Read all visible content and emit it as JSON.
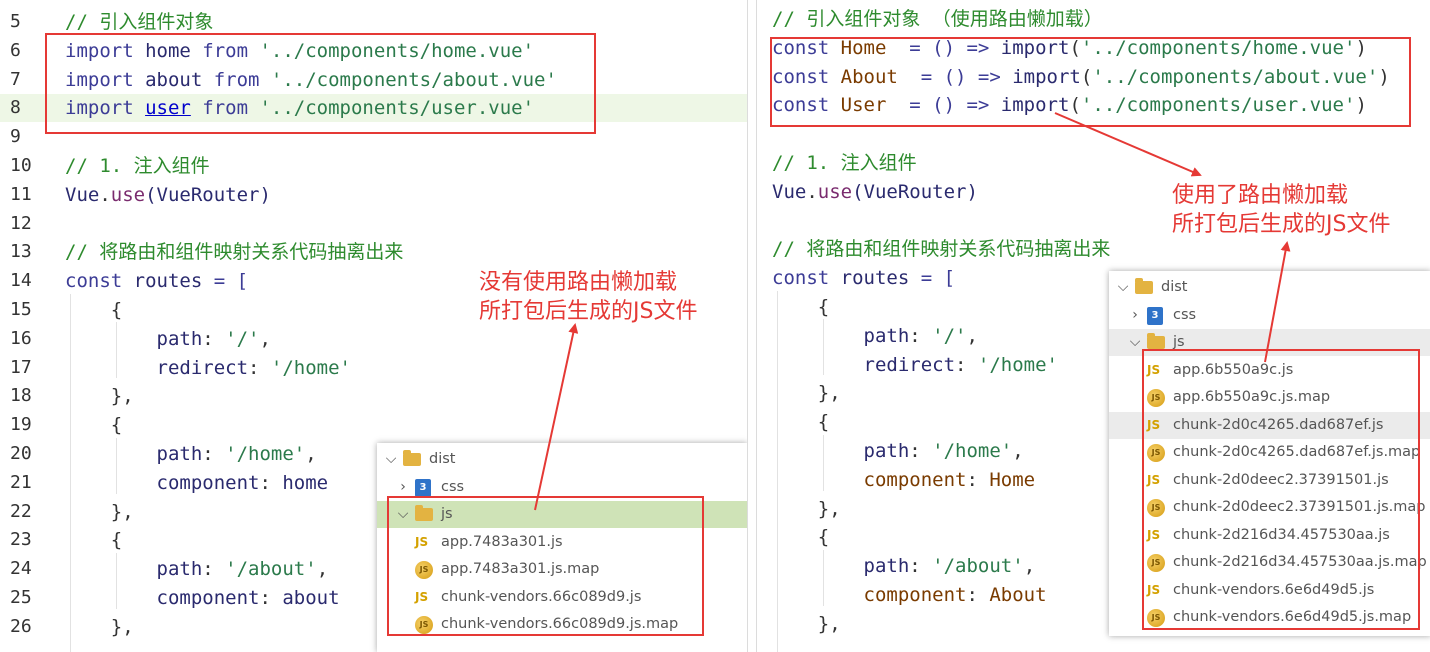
{
  "left": {
    "lines": [
      {
        "num": "5",
        "tokens": [
          {
            "t": "// 引入组件对象",
            "c": "comment"
          }
        ]
      },
      {
        "num": "6",
        "tokens": [
          {
            "t": "import ",
            "c": "kw"
          },
          {
            "t": "home ",
            "c": "ident"
          },
          {
            "t": "from ",
            "c": "kw"
          },
          {
            "t": "'../components/home.vue'",
            "c": "str"
          }
        ]
      },
      {
        "num": "7",
        "tokens": [
          {
            "t": "import ",
            "c": "kw"
          },
          {
            "t": "about ",
            "c": "ident"
          },
          {
            "t": "from ",
            "c": "kw"
          },
          {
            "t": "'../components/about.vue'",
            "c": "str"
          }
        ]
      },
      {
        "num": "8",
        "tokens": [
          {
            "t": "import ",
            "c": "kw"
          },
          {
            "t": "user",
            "c": "link"
          },
          {
            "t": " from ",
            "c": "kw"
          },
          {
            "t": "'../components/user.vue'",
            "c": "str"
          }
        ]
      },
      {
        "num": "9",
        "tokens": []
      },
      {
        "num": "10",
        "tokens": [
          {
            "t": "// 1. 注入组件",
            "c": "comment"
          }
        ]
      },
      {
        "num": "11",
        "tokens": [
          {
            "t": "Vue",
            "c": "ident"
          },
          {
            "t": ".",
            "c": "punc"
          },
          {
            "t": "use",
            "c": "prop"
          },
          {
            "t": "(VueRouter)",
            "c": "ident"
          }
        ]
      },
      {
        "num": "12",
        "tokens": []
      },
      {
        "num": "13",
        "tokens": [
          {
            "t": "// 将路由和组件映射关系代码抽离出来",
            "c": "comment"
          }
        ]
      },
      {
        "num": "14",
        "tokens": [
          {
            "t": "const ",
            "c": "kw"
          },
          {
            "t": "routes ",
            "c": "ident"
          },
          {
            "t": "= [",
            "c": "op"
          }
        ]
      },
      {
        "num": "15",
        "tokens": [
          {
            "t": "    {",
            "c": "punc"
          }
        ]
      },
      {
        "num": "16",
        "tokens": [
          {
            "t": "        path",
            "c": "ident"
          },
          {
            "t": ": ",
            "c": "punc"
          },
          {
            "t": "'/'",
            "c": "str"
          },
          {
            "t": ",",
            "c": "punc"
          }
        ]
      },
      {
        "num": "17",
        "tokens": [
          {
            "t": "        redirect",
            "c": "ident"
          },
          {
            "t": ": ",
            "c": "punc"
          },
          {
            "t": "'/home'",
            "c": "str"
          }
        ]
      },
      {
        "num": "18",
        "tokens": [
          {
            "t": "    },",
            "c": "punc"
          }
        ]
      },
      {
        "num": "19",
        "tokens": [
          {
            "t": "    {",
            "c": "punc"
          }
        ]
      },
      {
        "num": "20",
        "tokens": [
          {
            "t": "        path",
            "c": "ident"
          },
          {
            "t": ": ",
            "c": "punc"
          },
          {
            "t": "'/home'",
            "c": "str"
          },
          {
            "t": ",",
            "c": "punc"
          }
        ]
      },
      {
        "num": "21",
        "tokens": [
          {
            "t": "        component",
            "c": "ident"
          },
          {
            "t": ": ",
            "c": "punc"
          },
          {
            "t": "home",
            "c": "ident"
          }
        ]
      },
      {
        "num": "22",
        "tokens": [
          {
            "t": "    },",
            "c": "punc"
          }
        ]
      },
      {
        "num": "23",
        "tokens": [
          {
            "t": "    {",
            "c": "punc"
          }
        ]
      },
      {
        "num": "24",
        "tokens": [
          {
            "t": "        path",
            "c": "ident"
          },
          {
            "t": ": ",
            "c": "punc"
          },
          {
            "t": "'/about'",
            "c": "str"
          },
          {
            "t": ",",
            "c": "punc"
          }
        ]
      },
      {
        "num": "25",
        "tokens": [
          {
            "t": "        component",
            "c": "ident"
          },
          {
            "t": ": ",
            "c": "punc"
          },
          {
            "t": "about",
            "c": "ident"
          }
        ]
      },
      {
        "num": "26",
        "tokens": [
          {
            "t": "    },",
            "c": "punc"
          }
        ]
      }
    ],
    "annotation": [
      "没有使用路由懒加载",
      "所打包后生成的JS文件"
    ],
    "explorer": {
      "rows": [
        {
          "label": "dist",
          "chev": "⌵",
          "icon": "folder",
          "state": ""
        },
        {
          "label": "css",
          "chev": "›",
          "icon": "css",
          "state": ""
        },
        {
          "label": "js",
          "chev": "⌵",
          "icon": "folder",
          "state": "selected"
        },
        {
          "label": "app.7483a301.js",
          "chev": "",
          "icon": "js",
          "state": ""
        },
        {
          "label": "app.7483a301.js.map",
          "chev": "",
          "icon": "map",
          "state": ""
        },
        {
          "label": "chunk-vendors.66c089d9.js",
          "chev": "",
          "icon": "js",
          "state": ""
        },
        {
          "label": "chunk-vendors.66c089d9.js.map",
          "chev": "",
          "icon": "map",
          "state": ""
        }
      ]
    }
  },
  "right": {
    "lines": [
      {
        "tokens": [
          {
            "t": "// 引入组件对象 （使用路由懒加载）",
            "c": "comment"
          }
        ]
      },
      {
        "tokens": [
          {
            "t": "const ",
            "c": "kw"
          },
          {
            "t": "Home  ",
            "c": "cls"
          },
          {
            "t": "= () => ",
            "c": "op"
          },
          {
            "t": "import",
            "c": "ident"
          },
          {
            "t": "(",
            "c": "punc"
          },
          {
            "t": "'../components/home.vue'",
            "c": "str"
          },
          {
            "t": ")",
            "c": "punc"
          }
        ]
      },
      {
        "tokens": [
          {
            "t": "const ",
            "c": "kw"
          },
          {
            "t": "About  ",
            "c": "cls"
          },
          {
            "t": "= () => ",
            "c": "op"
          },
          {
            "t": "import",
            "c": "ident"
          },
          {
            "t": "(",
            "c": "punc"
          },
          {
            "t": "'../components/about.vue'",
            "c": "str"
          },
          {
            "t": ")",
            "c": "punc"
          }
        ]
      },
      {
        "tokens": [
          {
            "t": "const ",
            "c": "kw"
          },
          {
            "t": "User  ",
            "c": "cls"
          },
          {
            "t": "= () => ",
            "c": "op"
          },
          {
            "t": "import",
            "c": "ident"
          },
          {
            "t": "(",
            "c": "punc"
          },
          {
            "t": "'../components/user.vue'",
            "c": "str"
          },
          {
            "t": ")",
            "c": "punc"
          }
        ]
      },
      {
        "tokens": []
      },
      {
        "tokens": [
          {
            "t": "// 1. 注入组件",
            "c": "comment"
          }
        ]
      },
      {
        "tokens": [
          {
            "t": "Vue",
            "c": "ident"
          },
          {
            "t": ".",
            "c": "punc"
          },
          {
            "t": "use",
            "c": "prop"
          },
          {
            "t": "(VueRouter)",
            "c": "ident"
          }
        ]
      },
      {
        "tokens": []
      },
      {
        "tokens": [
          {
            "t": "// 将路由和组件映射关系代码抽离出来",
            "c": "comment"
          }
        ]
      },
      {
        "tokens": [
          {
            "t": "const ",
            "c": "kw"
          },
          {
            "t": "routes ",
            "c": "ident"
          },
          {
            "t": "= [",
            "c": "op"
          }
        ]
      },
      {
        "tokens": [
          {
            "t": "    {",
            "c": "punc"
          }
        ]
      },
      {
        "tokens": [
          {
            "t": "        path",
            "c": "ident"
          },
          {
            "t": ": ",
            "c": "punc"
          },
          {
            "t": "'/'",
            "c": "str"
          },
          {
            "t": ",",
            "c": "punc"
          }
        ]
      },
      {
        "tokens": [
          {
            "t": "        redirect",
            "c": "ident"
          },
          {
            "t": ": ",
            "c": "punc"
          },
          {
            "t": "'/home'",
            "c": "str"
          }
        ]
      },
      {
        "tokens": [
          {
            "t": "    },",
            "c": "punc"
          }
        ]
      },
      {
        "tokens": [
          {
            "t": "    {",
            "c": "punc"
          }
        ]
      },
      {
        "tokens": [
          {
            "t": "        path",
            "c": "ident"
          },
          {
            "t": ": ",
            "c": "punc"
          },
          {
            "t": "'/home'",
            "c": "str"
          },
          {
            "t": ",",
            "c": "punc"
          }
        ]
      },
      {
        "tokens": [
          {
            "t": "        component",
            "c": "cls"
          },
          {
            "t": ": ",
            "c": "punc"
          },
          {
            "t": "Home",
            "c": "cls"
          }
        ]
      },
      {
        "tokens": [
          {
            "t": "    },",
            "c": "punc"
          }
        ]
      },
      {
        "tokens": [
          {
            "t": "    {",
            "c": "punc"
          }
        ]
      },
      {
        "tokens": [
          {
            "t": "        path",
            "c": "ident"
          },
          {
            "t": ": ",
            "c": "punc"
          },
          {
            "t": "'/about'",
            "c": "str"
          },
          {
            "t": ",",
            "c": "punc"
          }
        ]
      },
      {
        "tokens": [
          {
            "t": "        component",
            "c": "cls"
          },
          {
            "t": ": ",
            "c": "punc"
          },
          {
            "t": "About",
            "c": "cls"
          }
        ]
      },
      {
        "tokens": [
          {
            "t": "    },",
            "c": "punc"
          }
        ]
      }
    ],
    "annotation": [
      "使用了路由懒加载",
      "所打包后生成的JS文件"
    ],
    "explorer": {
      "rows": [
        {
          "label": "dist",
          "chev": "⌵",
          "icon": "folder",
          "state": ""
        },
        {
          "label": "css",
          "chev": "›",
          "icon": "css",
          "state": ""
        },
        {
          "label": "js",
          "chev": "⌵",
          "icon": "folder",
          "state": "hovered"
        },
        {
          "label": "app.6b550a9c.js",
          "chev": "",
          "icon": "js",
          "state": ""
        },
        {
          "label": "app.6b550a9c.js.map",
          "chev": "",
          "icon": "map",
          "state": ""
        },
        {
          "label": "chunk-2d0c4265.dad687ef.js",
          "chev": "",
          "icon": "js",
          "state": "hovered"
        },
        {
          "label": "chunk-2d0c4265.dad687ef.js.map",
          "chev": "",
          "icon": "map",
          "state": ""
        },
        {
          "label": "chunk-2d0deec2.37391501.js",
          "chev": "",
          "icon": "js",
          "state": ""
        },
        {
          "label": "chunk-2d0deec2.37391501.js.map",
          "chev": "",
          "icon": "map",
          "state": ""
        },
        {
          "label": "chunk-2d216d34.457530aa.js",
          "chev": "",
          "icon": "js",
          "state": ""
        },
        {
          "label": "chunk-2d216d34.457530aa.js.map",
          "chev": "",
          "icon": "map",
          "state": ""
        },
        {
          "label": "chunk-vendors.6e6d49d5.js",
          "chev": "",
          "icon": "js",
          "state": ""
        },
        {
          "label": "chunk-vendors.6e6d49d5.js.map",
          "chev": "",
          "icon": "map",
          "state": ""
        }
      ]
    }
  },
  "icon_text": {
    "js": "JS",
    "css": "3",
    "map": "JS"
  },
  "colors": {
    "accent_red": "#e53935",
    "selected_row": "#cfe3b7",
    "highlight_line": "#eef7e6"
  }
}
